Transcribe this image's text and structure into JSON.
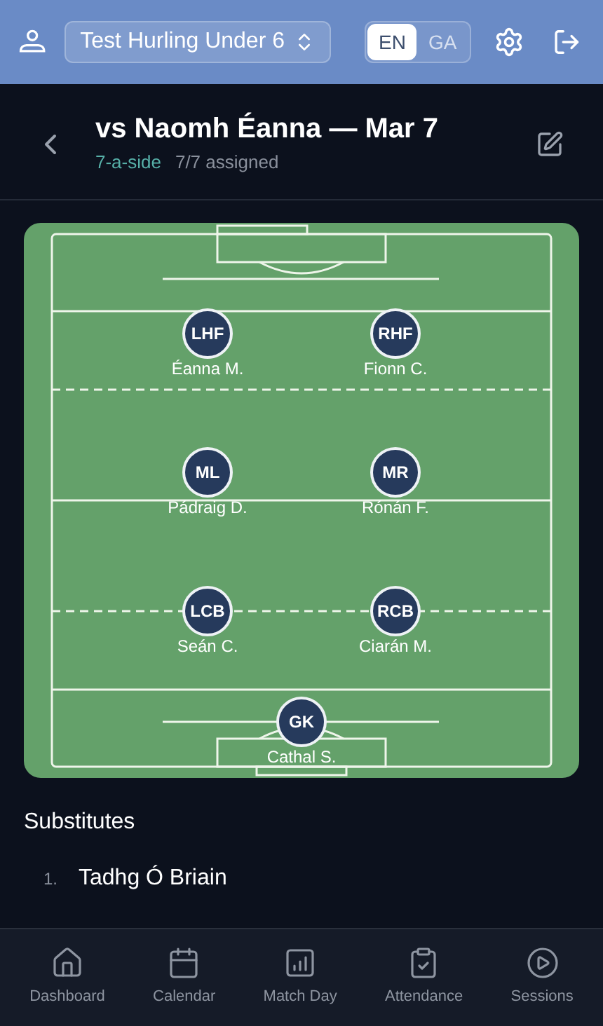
{
  "header": {
    "team": "Test Hurling Under 6",
    "languages": [
      {
        "label": "EN",
        "selected": true
      },
      {
        "label": "GA",
        "selected": false
      }
    ]
  },
  "match": {
    "title": "vs Naomh Éanna — Mar 7",
    "format": "7-a-side",
    "assigned": "7/7 assigned"
  },
  "pitch": {
    "lines": [
      {
        "players": [
          {
            "position": "LHF",
            "name": "Éanna M."
          },
          {
            "position": "RHF",
            "name": "Fionn C."
          }
        ]
      },
      {
        "players": [
          {
            "position": "ML",
            "name": "Pádraig D."
          },
          {
            "position": "MR",
            "name": "Rónán F."
          }
        ]
      },
      {
        "players": [
          {
            "position": "LCB",
            "name": "Seán C."
          },
          {
            "position": "RCB",
            "name": "Ciarán M."
          }
        ]
      },
      {
        "players": [
          {
            "position": "GK",
            "name": "Cathal S."
          }
        ]
      }
    ]
  },
  "substitutes": {
    "heading": "Substitutes",
    "items": [
      {
        "number": "1.",
        "name": "Tadhg Ó Briain"
      }
    ]
  },
  "nav": [
    {
      "kind": "home",
      "label": "Dashboard"
    },
    {
      "kind": "calendar",
      "label": "Calendar"
    },
    {
      "kind": "chart",
      "label": "Match Day"
    },
    {
      "kind": "clipboard",
      "label": "Attendance"
    },
    {
      "kind": "play",
      "label": "Sessions"
    }
  ]
}
